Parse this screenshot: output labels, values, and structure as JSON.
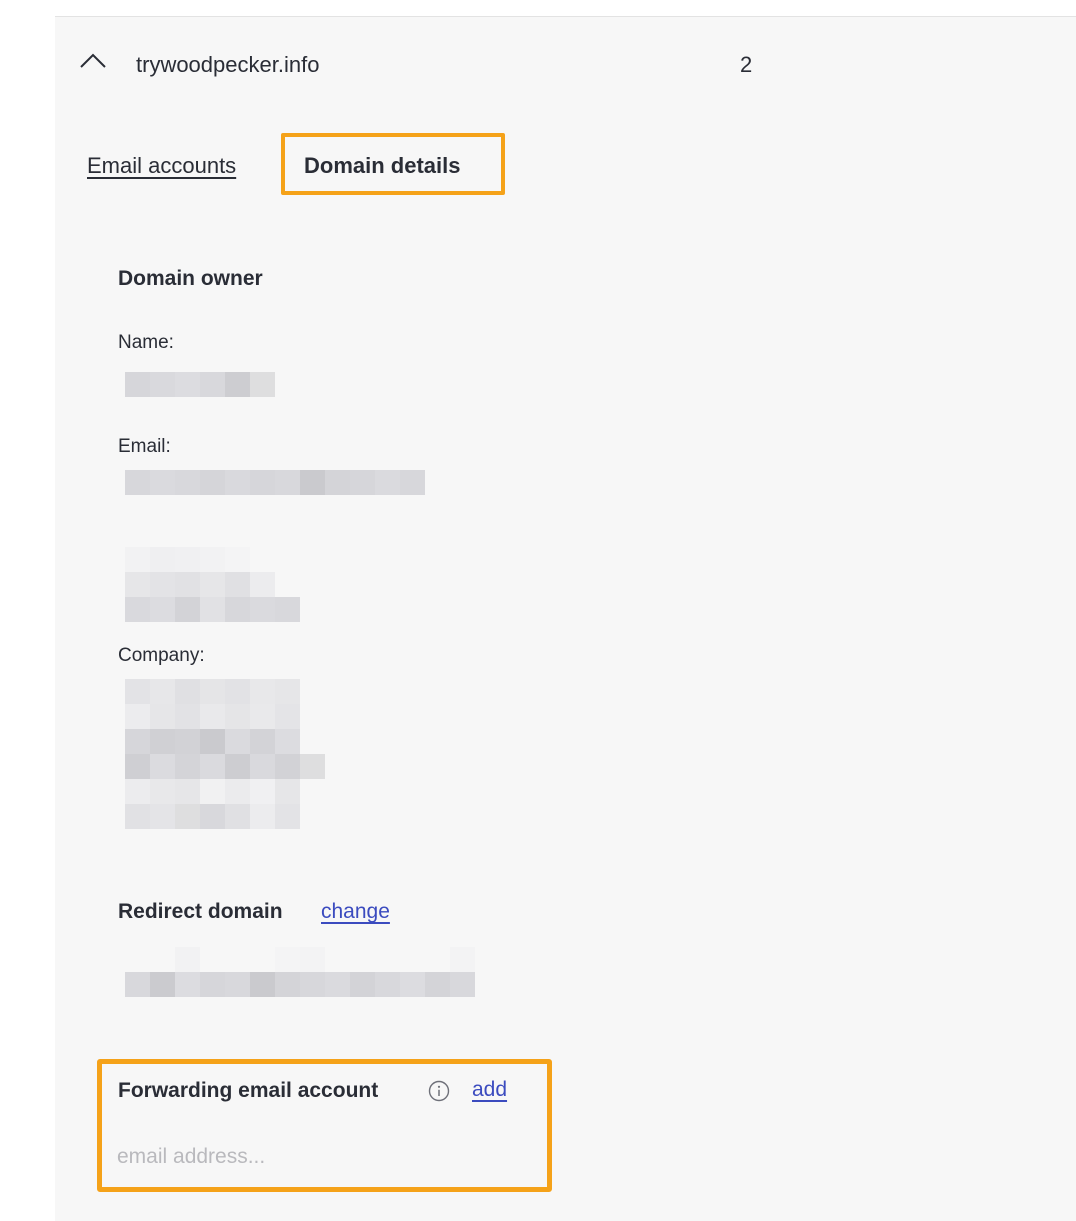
{
  "domain_row": {
    "domain": "trywoodpecker.info",
    "count": "2",
    "chevron_icon": "chevron-up-icon"
  },
  "tabs": {
    "email_accounts": "Email accounts",
    "domain_details": "Domain details",
    "active": "Domain details"
  },
  "owner": {
    "title": "Domain owner",
    "name_label": "Name:",
    "email_label": "Email:",
    "company_label": "Company:"
  },
  "redirect": {
    "title": "Redirect domain",
    "change_label": "change"
  },
  "forwarding": {
    "title": "Forwarding email account",
    "info_icon": "info-icon",
    "add_label": "add",
    "placeholder": "email address..."
  },
  "colors": {
    "highlight": "#f5a219",
    "link": "#3b4bbf",
    "panel_bg": "#f7f7f7",
    "text": "#2a2d36"
  }
}
